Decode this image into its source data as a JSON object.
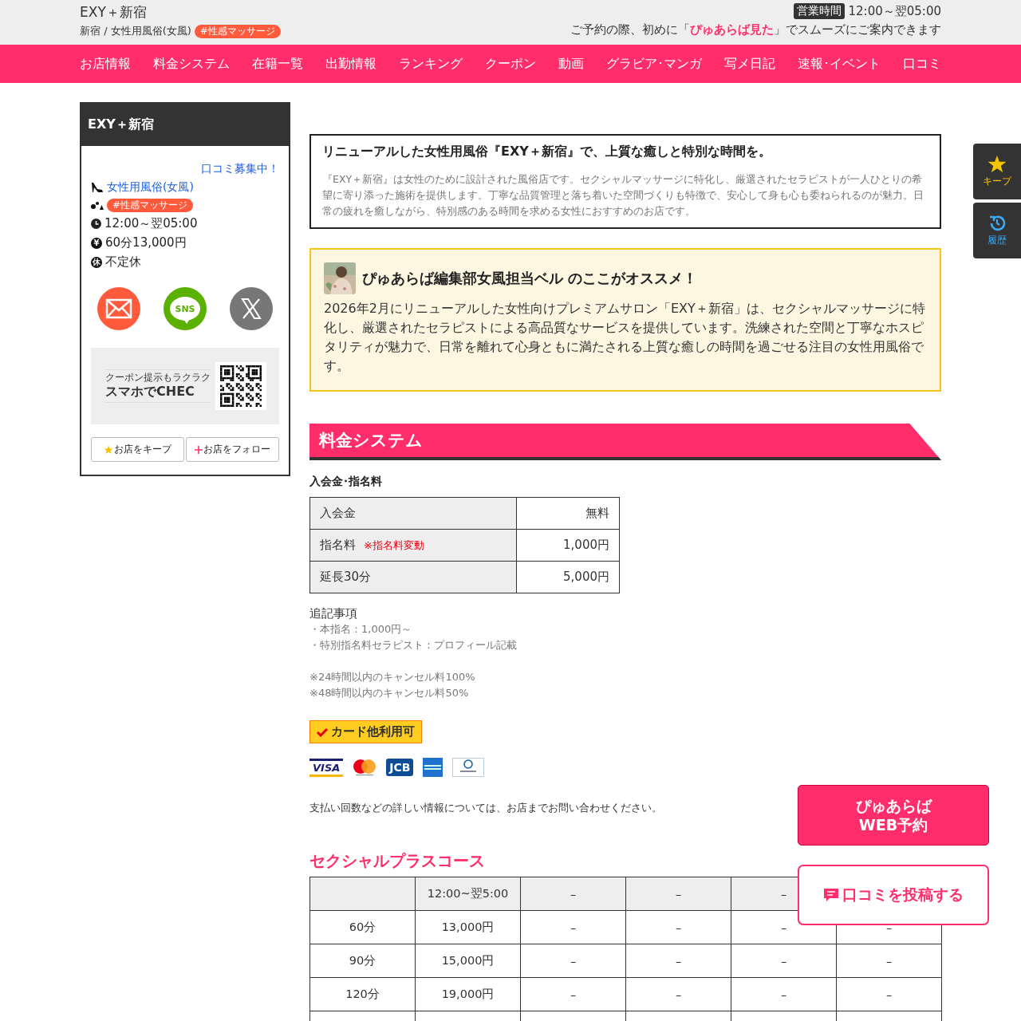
{
  "header": {
    "title": "EXY＋新宿",
    "breadcrumb": "新宿 / 女性用風俗(女風)",
    "tag": "#性感マッサージ",
    "hours_label": "営業時間",
    "hours": "12:00～翌05:00",
    "notice": "ご予約の際、初めに「**ぴゅあらば見た**」でスムーズにご案内できます"
  },
  "nav": [
    {
      "label": "お店情報",
      "selected": false
    },
    {
      "label": "料金システム",
      "selected": false
    },
    {
      "label": "在籍一覧",
      "selected": false
    },
    {
      "label": "出勤情報",
      "selected": false
    },
    {
      "label": "ランキング",
      "selected": false
    },
    {
      "label": "クーポン",
      "selected": false
    },
    {
      "label": "動画",
      "selected": false
    },
    {
      "label": "グラビア･マンガ",
      "selected": false
    },
    {
      "label": "写メ日記",
      "selected": false
    },
    {
      "label": "速報･イベント",
      "selected": false
    },
    {
      "label": "口コミ",
      "selected": false
    }
  ],
  "sidebar": {
    "title": "EXY＋新宿",
    "review_link": "口コミ募集中！",
    "info": [
      {
        "kind": "genre",
        "text": "女性用風俗(女風)"
      },
      {
        "kind": "tag",
        "text": "#性感マッサージ"
      },
      {
        "kind": "hours",
        "text": "12:00～翌05:00"
      },
      {
        "kind": "price",
        "glyph": "¥",
        "text": "60分13,000円"
      },
      {
        "kind": "holiday",
        "glyph": "休",
        "text": "不定休"
      }
    ],
    "share": [
      {
        "kind": "mail"
      },
      {
        "kind": "sns",
        "label": "SNS"
      },
      {
        "kind": "x"
      }
    ],
    "qr": {
      "caption": "クーポン提示もラクラク",
      "title": "スマホでCHEC"
    },
    "buttons": [
      {
        "kind": "keep",
        "label": "お店をキープ"
      },
      {
        "kind": "follow",
        "label": "お店をフォロー"
      }
    ]
  },
  "intro": {
    "heading": "リニューアルした女性用風俗『EXY＋新宿』で、上質な癒しと特別な時間を。",
    "body": "『EXY＋新宿』は女性のために設計された風俗店です。セクシャルマッサージに特化し、厳選されたセラピストが一人ひとりの希望に寄り添った施術を提供します。丁寧な品質管理と落ち着いた空間づくりも特徴で、安心して身も心も委ねられるのが魅力。日常の疲れを癒しながら、特別感のある時間を求める女性におすすめのお店です。"
  },
  "recommend": {
    "heading": "ぴゅあらば編集部女風担当ベル のここがオススメ！",
    "body": "2026年2月にリニューアルした女性向けプレミアムサロン「EXY＋新宿」は、セクシャルマッサージに特化し、厳選されたセラピストによる高品質なサービスを提供しています。洗練された空間と丁寧なホスピタリティが魅力で、日常を離れて心身ともに満たされる上質な癒しの時間を過ごせる注目の女性用風俗です。"
  },
  "pricing": {
    "title": "料金システム",
    "fees_heading": "入会金･指名料",
    "fees": [
      {
        "label": "入会金",
        "value": "無料"
      },
      {
        "label": "指名料",
        "note": "※指名料変動",
        "value": "1,000円"
      },
      {
        "label": "延長30分",
        "value": "5,000円"
      }
    ],
    "notes_heading": "追記事項",
    "notes": [
      "・本指名：1,000円～",
      "・特別指名料セラピスト：プロフィール記載"
    ],
    "cancel": [
      "※24時間以内のキャンセル料100%",
      "※48時間以内のキャンセル料50%"
    ],
    "card_badge": "カード他利用可",
    "cards": [
      {
        "kind": "visa",
        "label": "VISA"
      },
      {
        "kind": "mastercard"
      },
      {
        "kind": "jcb",
        "label": "JCB"
      },
      {
        "kind": "amex"
      },
      {
        "kind": "diners"
      }
    ],
    "payment_note": "支払い回数などの詳しい情報については、お店までお問い合わせください。"
  },
  "course": {
    "title": "セクシャルプラスコース",
    "header": [
      {
        "kind": "blank"
      },
      {
        "kind": "text",
        "text": "12:00~翌5:00"
      },
      {
        "kind": "text",
        "text": "–"
      },
      {
        "kind": "text",
        "text": "–"
      },
      {
        "kind": "text",
        "text": "–"
      },
      {
        "kind": "blank"
      }
    ],
    "rows": [
      {
        "kind": "data",
        "cells": [
          "60分",
          "13,000円",
          "–",
          "–",
          "–",
          "–"
        ]
      },
      {
        "kind": "data",
        "cells": [
          "90分",
          "15,000円",
          "–",
          "–",
          "–",
          "–"
        ]
      },
      {
        "kind": "data",
        "cells": [
          "120分",
          "19,000円",
          "–",
          "–",
          "–",
          "–"
        ]
      },
      {
        "kind": "blank"
      }
    ]
  },
  "side_tabs": [
    {
      "kind": "keep",
      "label": "キープ"
    },
    {
      "kind": "history",
      "label": "履歴"
    }
  ],
  "floating": {
    "booking": [
      "ぴゅあらば",
      "WEB予約"
    ],
    "review": "口コミを投稿する"
  }
}
